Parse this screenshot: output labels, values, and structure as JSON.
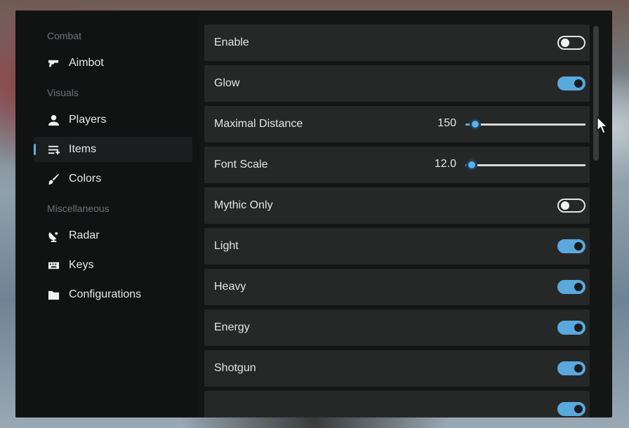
{
  "sidebar": {
    "sections": [
      {
        "title": "Combat",
        "items": [
          {
            "label": "Aimbot",
            "icon": "gun-icon"
          }
        ]
      },
      {
        "title": "Visuals",
        "items": [
          {
            "label": "Players",
            "icon": "person-icon"
          },
          {
            "label": "Items",
            "icon": "list-add-icon",
            "active": true
          },
          {
            "label": "Colors",
            "icon": "brush-icon"
          }
        ]
      },
      {
        "title": "Miscellaneous",
        "items": [
          {
            "label": "Radar",
            "icon": "radar-icon"
          },
          {
            "label": "Keys",
            "icon": "keyboard-icon"
          },
          {
            "label": "Configurations",
            "icon": "folder-icon"
          }
        ]
      }
    ]
  },
  "settings": {
    "enable": {
      "label": "Enable",
      "on": false
    },
    "glow": {
      "label": "Glow",
      "on": true
    },
    "max_distance": {
      "label": "Maximal Distance",
      "value": "150",
      "fraction": 0.08
    },
    "font_scale": {
      "label": "Font Scale",
      "value": "12.0",
      "fraction": 0.05
    },
    "mythic_only": {
      "label": "Mythic Only",
      "on": false
    },
    "light": {
      "label": "Light",
      "on": true
    },
    "heavy": {
      "label": "Heavy",
      "on": true
    },
    "energy": {
      "label": "Energy",
      "on": true
    },
    "shotgun": {
      "label": "Shotgun",
      "on": true
    }
  },
  "colors": {
    "accent": "#58a9dc",
    "row_bg": "#262727",
    "window_bg": "#141515"
  }
}
